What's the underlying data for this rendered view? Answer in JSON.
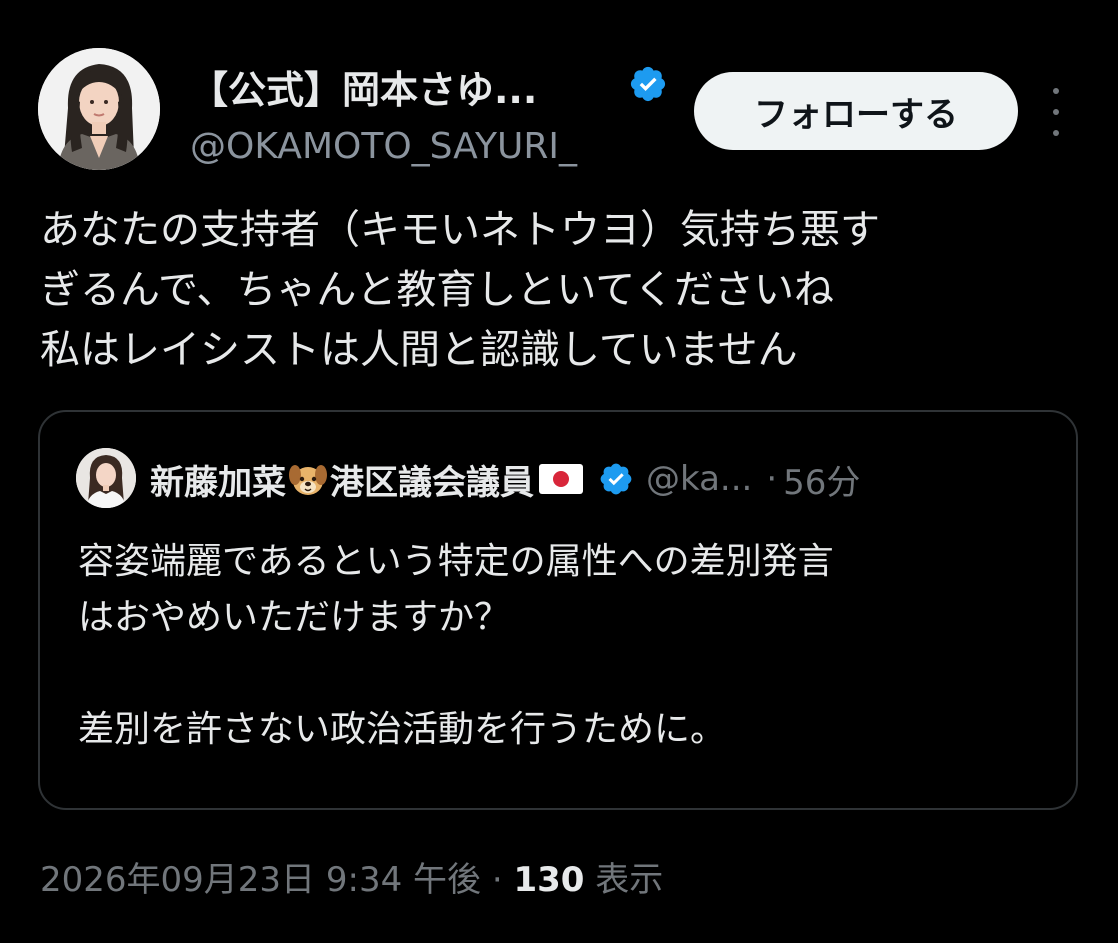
{
  "author": {
    "name": "【公式】岡本さゆ...",
    "handle": "@OKAMOTO_SAYURI_",
    "verified": true
  },
  "follow_button": {
    "label": "フォローする"
  },
  "tweet": {
    "lines": [
      "あなたの支持者（キモいネトウヨ）気持ち悪す",
      "ぎるんで、ちゃんと教育しといてくださいね",
      "私はレイシストは人間と認識していません"
    ]
  },
  "quoted_tweet": {
    "name_part1": "新藤加菜",
    "name_part2": "港区議会議員",
    "handle": "@ka...",
    "separator": "·",
    "time": "56分",
    "verified": true,
    "lines": [
      "容姿端麗であるという特定の属性への差別発言",
      "はおやめいただけますか？",
      "",
      "差別を許さない政治活動を行うために。"
    ]
  },
  "meta": {
    "timestamp": "2026年09月23日 9:34 午後",
    "separator": "·",
    "views_count": "130",
    "views_label": "表示"
  },
  "colors": {
    "background": "#000000",
    "text": "#e7e9ea",
    "secondary_text": "#71767b",
    "verified": "#1d9bf0",
    "follow_button_bg": "#eff3f4",
    "border": "#2f3336"
  }
}
